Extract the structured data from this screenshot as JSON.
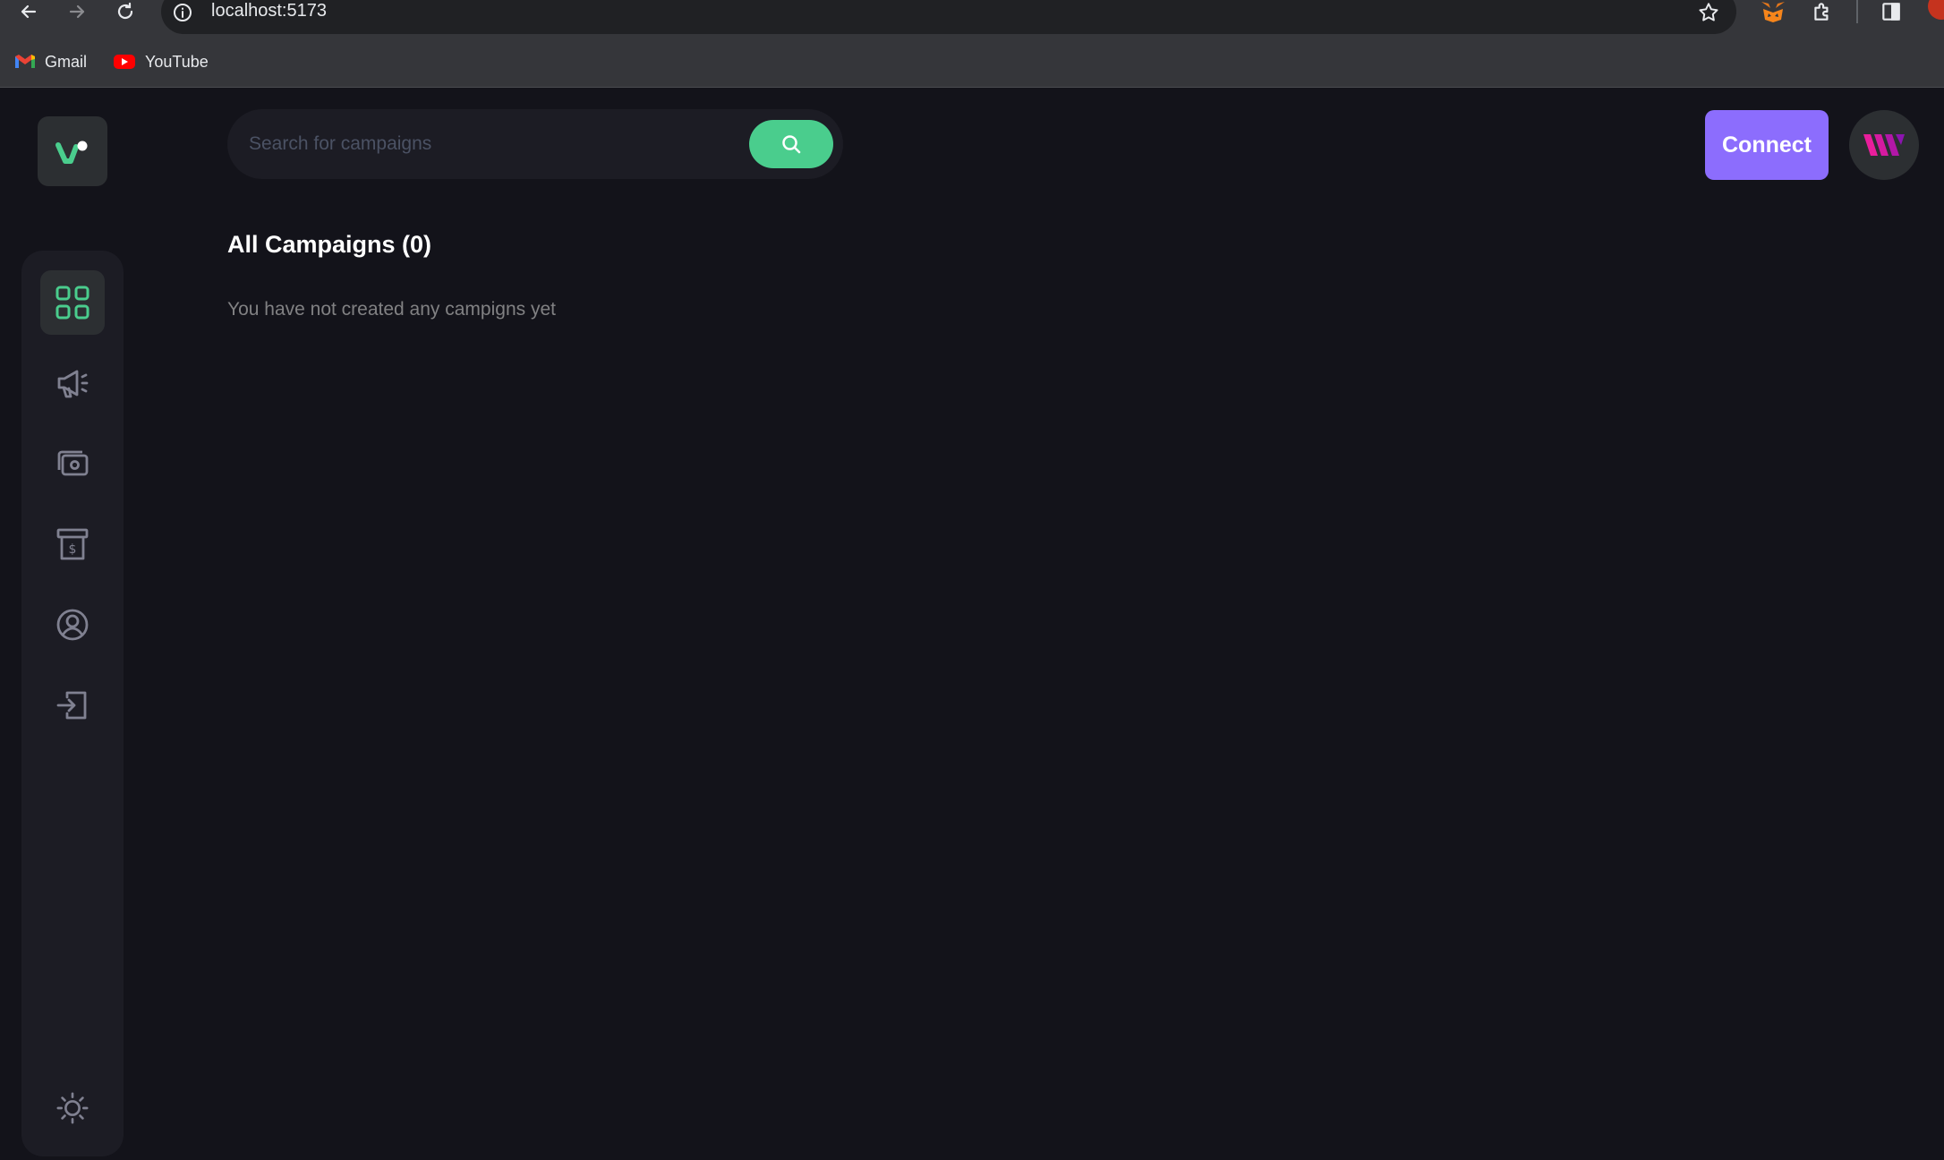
{
  "browser": {
    "url": "localhost:5173",
    "bookmarks": [
      {
        "label": "Gmail",
        "icon": "gmail-icon"
      },
      {
        "label": "YouTube",
        "icon": "youtube-icon"
      }
    ]
  },
  "app": {
    "search": {
      "placeholder": "Search for campaigns"
    },
    "connect_label": "Connect",
    "heading": "All Campaigns (0)",
    "empty_message": "You have not created any campigns yet",
    "sidebar": [
      {
        "name": "dashboard",
        "icon": "grid-icon",
        "active": true
      },
      {
        "name": "campaign",
        "icon": "megaphone-icon",
        "active": false
      },
      {
        "name": "payment",
        "icon": "payment-icon",
        "active": false
      },
      {
        "name": "withdraw",
        "icon": "withdraw-icon",
        "active": false
      },
      {
        "name": "profile",
        "icon": "profile-icon",
        "active": false
      },
      {
        "name": "logout",
        "icon": "logout-icon",
        "active": false
      }
    ],
    "theme_toggle": "sun-icon"
  },
  "colors": {
    "background": "#13131a",
    "sidebar": "#1c1c24",
    "accent_green": "#4acd8d",
    "accent_purple": "#8c6dfd"
  }
}
